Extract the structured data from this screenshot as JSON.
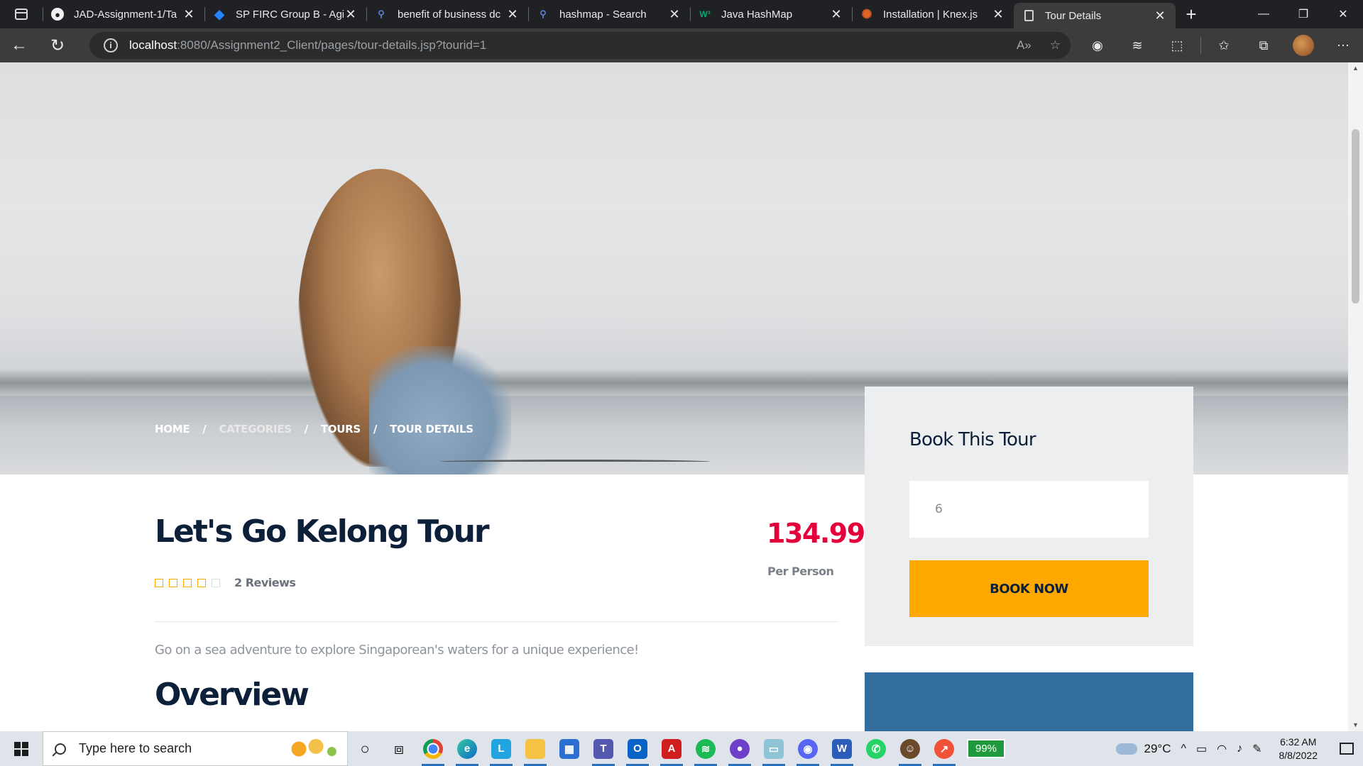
{
  "browser": {
    "tabs": [
      {
        "title": "JAD-Assignment-1/Ta",
        "icon": "github-icon",
        "active": false
      },
      {
        "title": "SP FIRC Group B - Agi",
        "icon": "jira-icon",
        "active": false
      },
      {
        "title": "benefit of business dc",
        "icon": "search-icon",
        "active": false
      },
      {
        "title": "hashmap - Search",
        "icon": "search-icon",
        "active": false
      },
      {
        "title": "Java HashMap",
        "icon": "w3schools-icon",
        "active": false
      },
      {
        "title": "Installation | Knex.js",
        "icon": "knex-icon",
        "active": false
      },
      {
        "title": "Tour Details",
        "icon": "page-icon",
        "active": true
      }
    ],
    "url_host": "localhost",
    "url_rest": ":8080/Assignment2_Client/pages/tour-details.jsp?tourid=1"
  },
  "page": {
    "breadcrumb": [
      "HOME",
      "CATEGORIES",
      "TOURS",
      "TOUR DETAILS"
    ],
    "booking": {
      "title": "Book This Tour",
      "quantity_value": "6",
      "button_label": "BOOK NOW"
    },
    "tour": {
      "title": "Let's Go Kelong Tour",
      "price": "134.99",
      "price_unit": "Per Person",
      "rating_stars": 4,
      "rating_max": 5,
      "reviews": "2 Reviews",
      "description": "Go on a sea adventure to explore Singaporean's waters for a unique experience!",
      "overview_heading": "Overview"
    }
  },
  "taskbar": {
    "search_placeholder": "Type here to search",
    "battery": "99%",
    "temperature": "29°C",
    "time": "6:32 AM",
    "date": "8/8/2022",
    "apps": [
      "cortana-icon",
      "task-view-icon",
      "chrome-icon",
      "edge-icon",
      "l-app-icon",
      "file-explorer-icon",
      "store-icon",
      "teams-icon",
      "outlook-icon",
      "acrobat-icon",
      "spotify-icon",
      "github-desktop-icon",
      "notepad-icon",
      "discord-icon",
      "word-icon",
      "whatsapp-icon",
      "avatar-app-icon",
      "swift-icon"
    ]
  },
  "colors": {
    "accent": "#ffa800",
    "price": "#e4003b",
    "heading": "#0c2039",
    "panel": "#edeef0",
    "promo": "#336e9f"
  }
}
